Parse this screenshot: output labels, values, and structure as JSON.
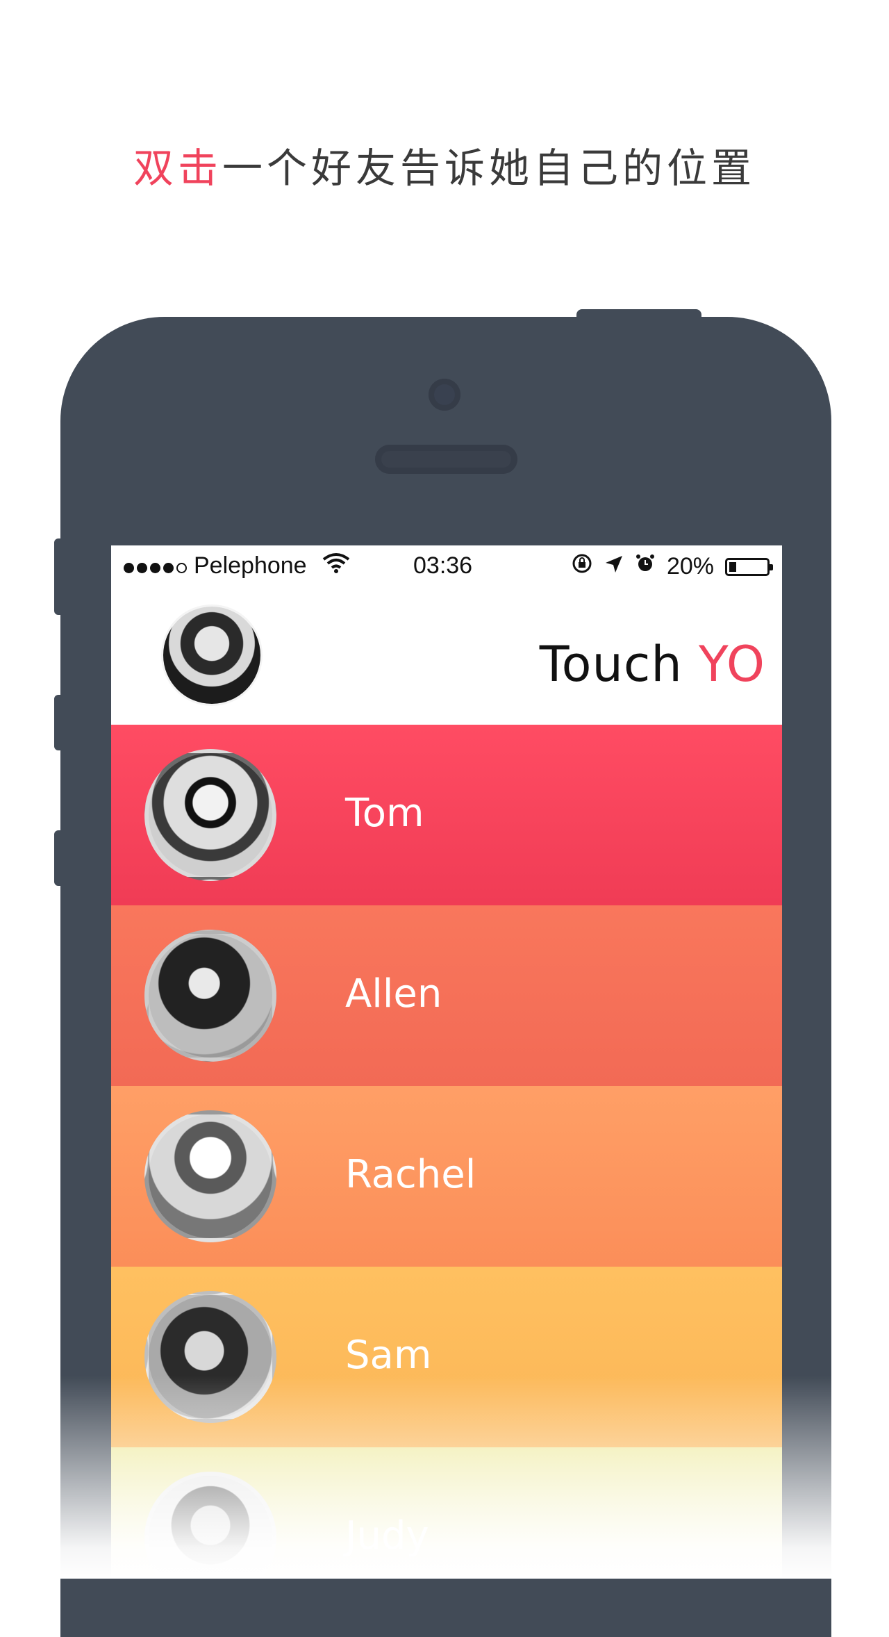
{
  "headline": {
    "accent": "双击",
    "rest": "一个好友告诉她自己的位置"
  },
  "statusbar": {
    "carrier": "Pelephone",
    "time": "03:36",
    "battery_text": "20%",
    "battery_level": 0.2
  },
  "app": {
    "title_part1": "Touch ",
    "title_part2": "YO"
  },
  "contacts": [
    {
      "name": "Tom"
    },
    {
      "name": "Allen"
    },
    {
      "name": "Rachel"
    },
    {
      "name": "Sam"
    },
    {
      "name": "Judy"
    }
  ],
  "colors": {
    "accent": "#f0435c",
    "phone": "#424b57",
    "row_tom": "#f64259",
    "row_allen": "#f57058",
    "row_rachel": "#fd965f",
    "row_sam": "#fdbb5b",
    "row_judy": "#f0ecb5"
  },
  "icons": [
    "wifi-icon",
    "rotation-lock-icon",
    "location-arrow-icon",
    "alarm-icon",
    "battery-icon"
  ]
}
